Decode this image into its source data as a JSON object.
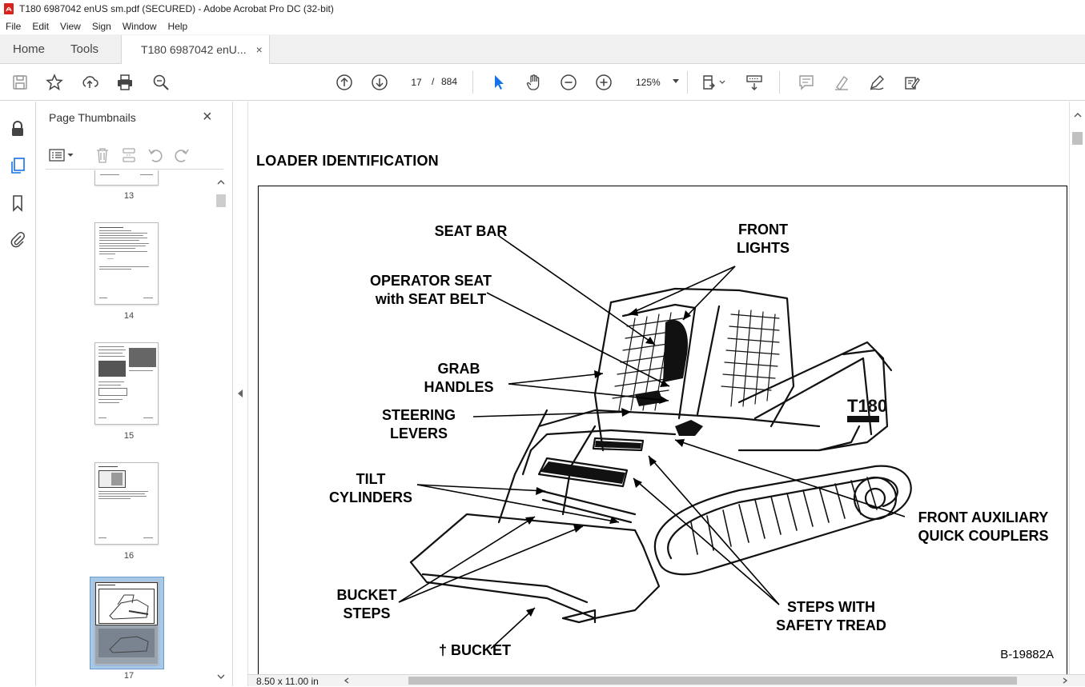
{
  "window": {
    "title": "T180 6987042 enUS sm.pdf (SECURED) - Adobe Acrobat Pro DC (32-bit)"
  },
  "menu": [
    "File",
    "Edit",
    "View",
    "Sign",
    "Window",
    "Help"
  ],
  "tabs": {
    "home": "Home",
    "tools": "Tools",
    "document": "T180 6987042 enU...",
    "close": "×"
  },
  "toolbar": {
    "current_page": "17",
    "page_separator": "/",
    "total_pages": "884",
    "zoom": "125%"
  },
  "thumbnail_panel": {
    "title": "Page Thumbnails",
    "close": "×",
    "pages": [
      "13",
      "14",
      "15",
      "16",
      "17"
    ],
    "selected_page": "17"
  },
  "document": {
    "heading": "LOADER IDENTIFICATION",
    "figure_code": "B-19882A",
    "callouts": {
      "seat_bar": "SEAT BAR",
      "front_lights_1": "FRONT",
      "front_lights_2": "LIGHTS",
      "operator_seat_1": "OPERATOR SEAT",
      "operator_seat_2": "with SEAT BELT",
      "grab_handles_1": "GRAB",
      "grab_handles_2": "HANDLES",
      "steering_levers_1": "STEERING",
      "steering_levers_2": "LEVERS",
      "tilt_cylinders_1": "TILT",
      "tilt_cylinders_2": "CYLINDERS",
      "front_aux_1": "FRONT AUXILIARY",
      "front_aux_2": "QUICK COUPLERS",
      "bucket_steps_1": "BUCKET",
      "bucket_steps_2": "STEPS",
      "steps_tread_1": "STEPS WITH",
      "steps_tread_2": "SAFETY TREAD",
      "bucket": "† BUCKET",
      "machine_label": "T180"
    }
  },
  "status": {
    "page_size": "8.50 x 11.00 in"
  },
  "colors": {
    "accent_blue": "#1473e6",
    "selection": "#a8c8e8",
    "pdf_red": "#d9231f"
  }
}
